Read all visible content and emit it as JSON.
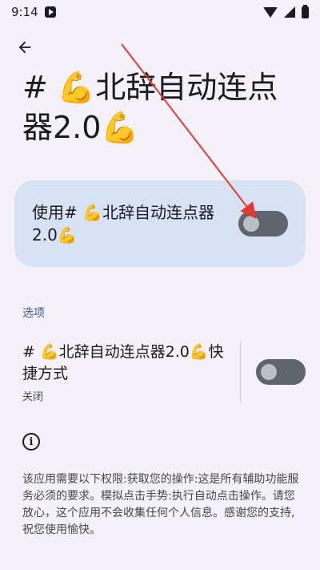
{
  "status_bar": {
    "time": "9:14"
  },
  "header": {
    "back_icon": "arrow-back-icon",
    "title": "# 💪北辞自动连点器2.0💪"
  },
  "main_card": {
    "label": "使用# 💪北辞自动连点器2.0💪",
    "switch_on": false
  },
  "options": {
    "section_title": "选项",
    "shortcut": {
      "title": "# 💪北辞自动连点器2.0💪快捷方式",
      "summary": "关闭",
      "switch_on": false
    }
  },
  "info": {
    "icon": "info-icon",
    "description": "该应用需要以下权限:获取您的操作:这是所有辅助功能服务必须的要求。模拟点击手势:执行自动点击操作。请您放心，这个应用不会收集任何个人信息。感谢您的支持,祝您使用愉快。"
  },
  "colors": {
    "background": "#f4f1f8",
    "card": "#d8e2f5",
    "accent": "#395d9c",
    "switch_track": "#5f646e",
    "annotation_arrow": "#e53935"
  }
}
